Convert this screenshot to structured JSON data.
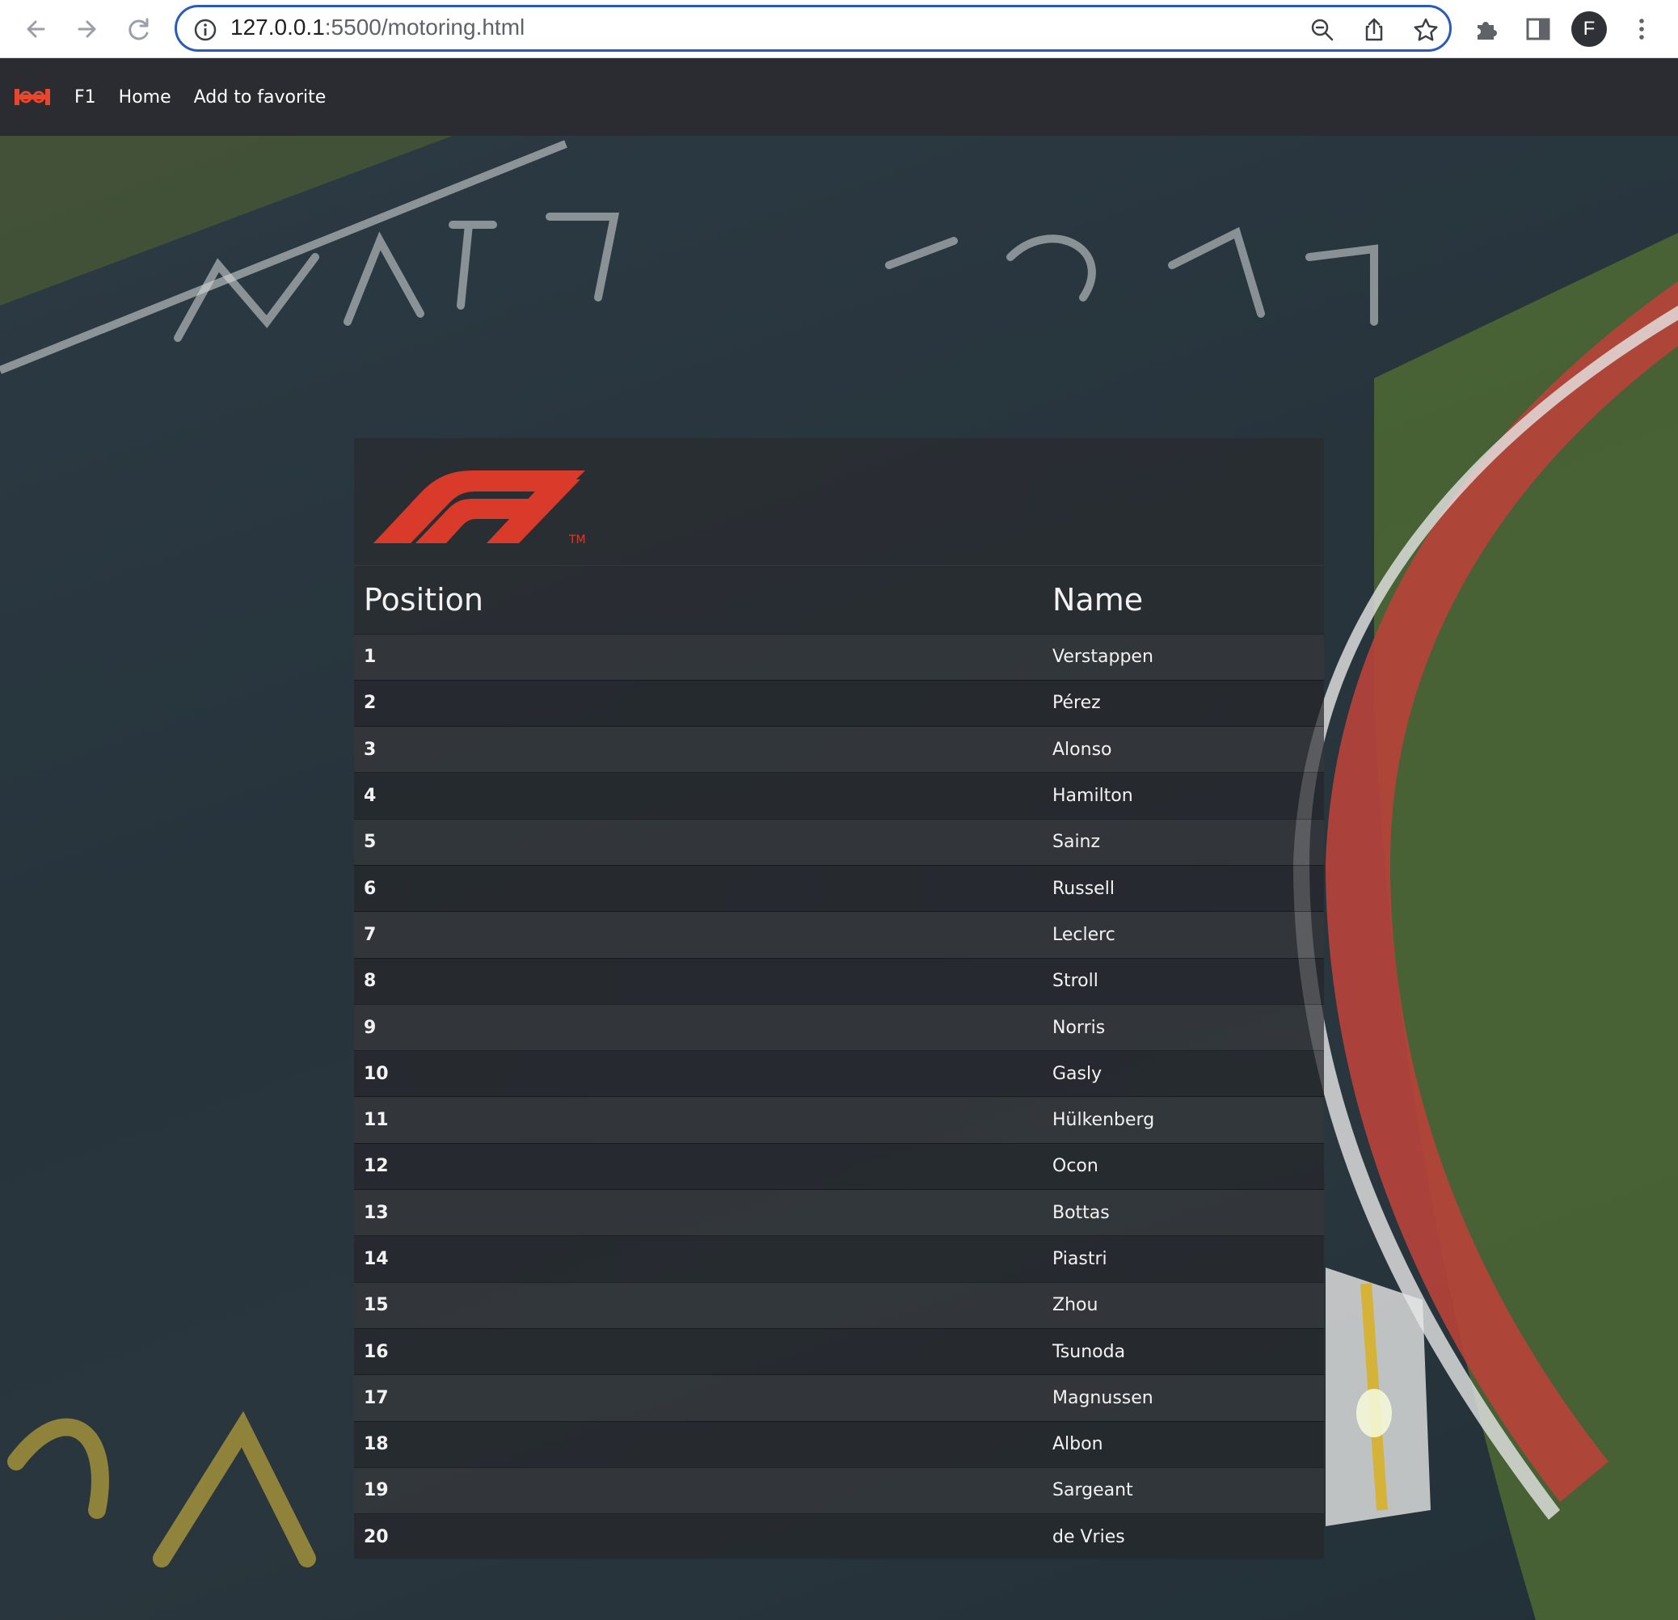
{
  "browser": {
    "url_host": "127.0.0.1",
    "url_path": ":5500/motoring.html",
    "profile_initial": "F"
  },
  "navbar": {
    "links": [
      "F1",
      "Home",
      "Add to favorite"
    ]
  },
  "logo": {
    "brand_color": "#d93a2a",
    "trademark": "TM"
  },
  "table": {
    "headers": {
      "position": "Position",
      "name": "Name"
    },
    "rows": [
      {
        "position": "1",
        "name": "Verstappen"
      },
      {
        "position": "2",
        "name": "Pérez"
      },
      {
        "position": "3",
        "name": "Alonso"
      },
      {
        "position": "4",
        "name": "Hamilton"
      },
      {
        "position": "5",
        "name": "Sainz"
      },
      {
        "position": "6",
        "name": "Russell"
      },
      {
        "position": "7",
        "name": "Leclerc"
      },
      {
        "position": "8",
        "name": "Stroll"
      },
      {
        "position": "9",
        "name": "Norris"
      },
      {
        "position": "10",
        "name": "Gasly"
      },
      {
        "position": "11",
        "name": "Hülkenberg"
      },
      {
        "position": "12",
        "name": "Ocon"
      },
      {
        "position": "13",
        "name": "Bottas"
      },
      {
        "position": "14",
        "name": "Piastri"
      },
      {
        "position": "15",
        "name": "Zhou"
      },
      {
        "position": "16",
        "name": "Tsunoda"
      },
      {
        "position": "17",
        "name": "Magnussen"
      },
      {
        "position": "18",
        "name": "Albon"
      },
      {
        "position": "19",
        "name": "Sargeant"
      },
      {
        "position": "20",
        "name": "de Vries"
      }
    ]
  }
}
